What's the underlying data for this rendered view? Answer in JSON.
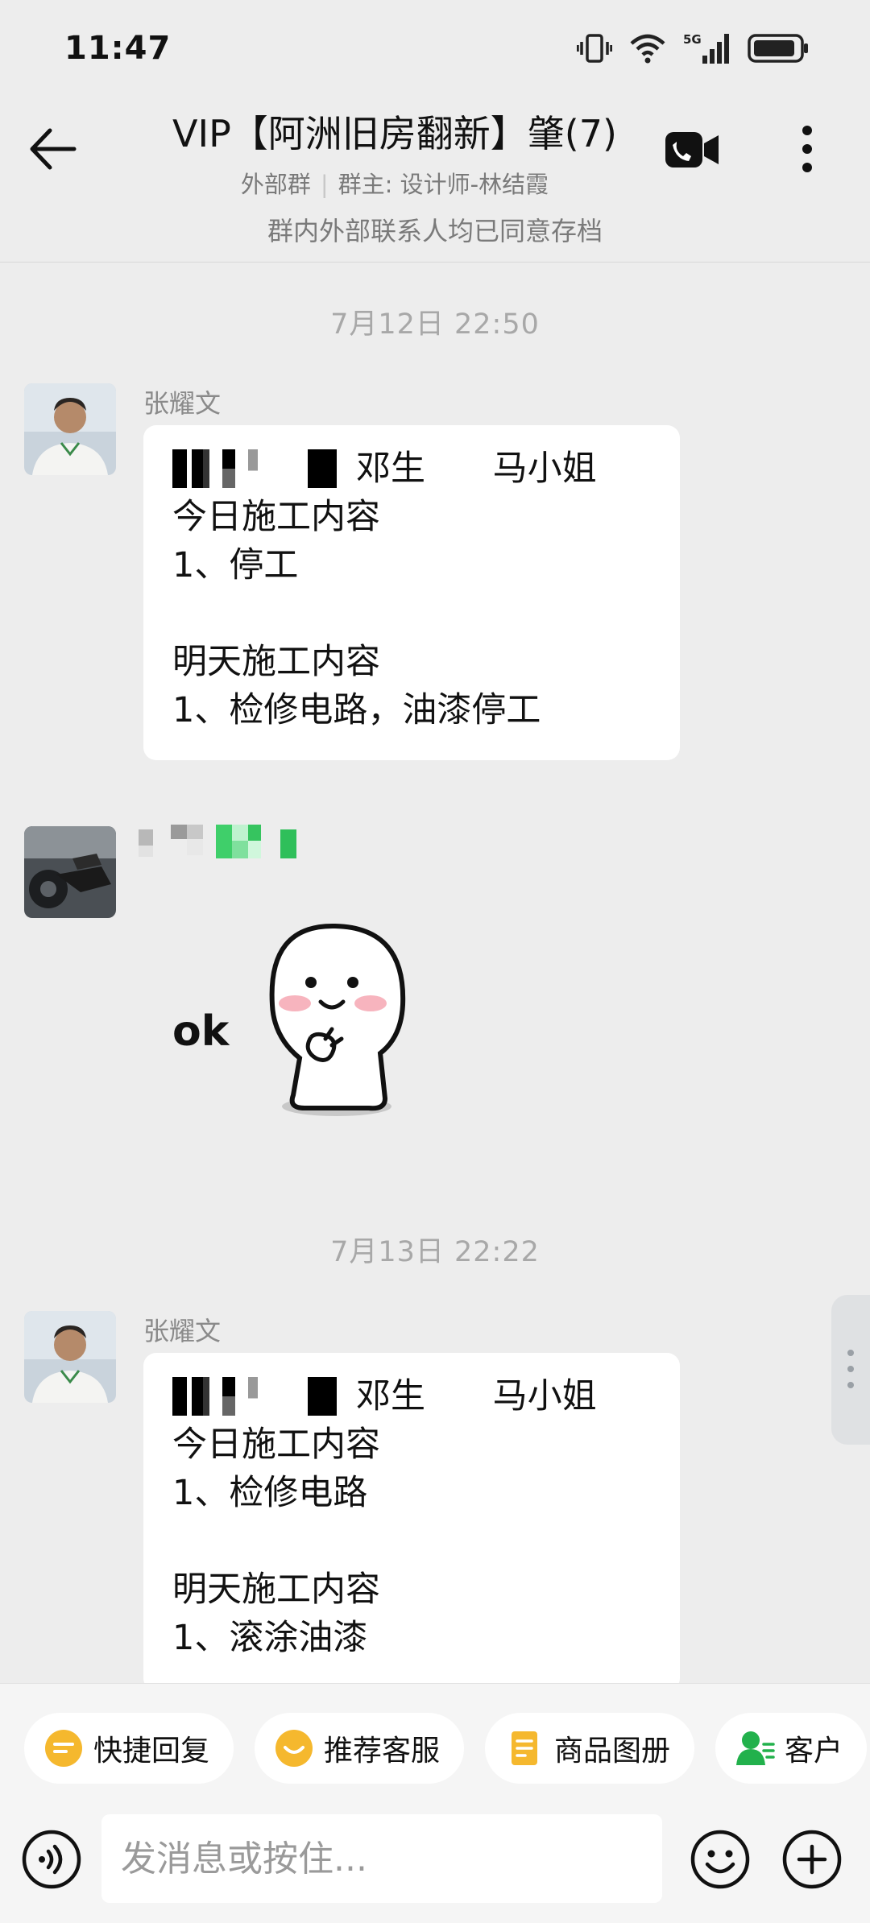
{
  "status_bar": {
    "time": "11:47",
    "icons": [
      "vibrate-icon",
      "wifi-icon",
      "signal-5g-icon",
      "battery-icon"
    ]
  },
  "header": {
    "title": "VIP【阿洲旧房翻新】肇(7)",
    "subtitle_type": "外部群",
    "subtitle_owner": "群主: 设计师-林结霞"
  },
  "notice": "群内外部联系人均已同意存档",
  "messages": [
    {
      "timestamp": "7月12日  22:50",
      "sender": "张耀文",
      "line1_a": "邓生",
      "line1_b": "马小姐",
      "line2": "今日施工内容",
      "line3": "1、停工",
      "line4": "",
      "line5": "明天施工内容",
      "line6": "1、检修电路，油漆停工"
    },
    {
      "sticker_text": "ok"
    },
    {
      "timestamp": "7月13日  22:22",
      "sender": "张耀文",
      "line1_a": "邓生",
      "line1_b": "马小姐",
      "line2": "今日施工内容",
      "line3": "1、检修电路",
      "line4": "",
      "line5": "明天施工内容",
      "line6": "1、滚涂油漆"
    }
  ],
  "quick_actions": [
    {
      "label": "快捷回复",
      "icon": "quick-reply-icon"
    },
    {
      "label": "推荐客服",
      "icon": "recommend-service-icon"
    },
    {
      "label": "商品图册",
      "icon": "product-catalog-icon"
    },
    {
      "label": "客户",
      "icon": "customer-icon"
    }
  ],
  "input": {
    "placeholder": "发消息或按住..."
  },
  "colors": {
    "background": "#ededed",
    "bubble": "#ffffff",
    "accent_yellow": "#f5b82e",
    "accent_green": "#22b14c"
  }
}
